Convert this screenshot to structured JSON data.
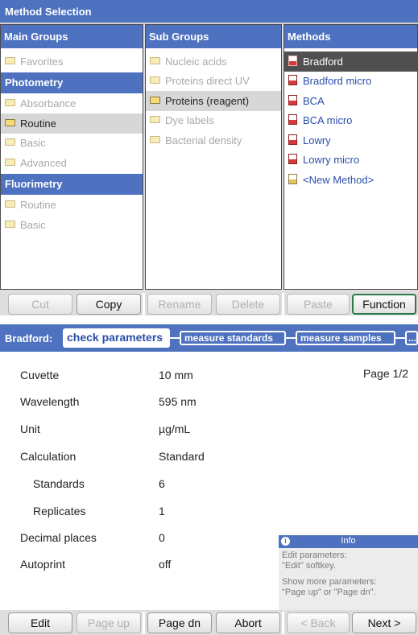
{
  "panel1": {
    "title": "Method Selection",
    "columns": {
      "main_groups": "Main Groups",
      "sub_groups": "Sub Groups",
      "methods": "Methods"
    },
    "main_groups": {
      "favorites": "Favorites",
      "photometry": "Photometry",
      "absorbance": "Absorbance",
      "routine": "Routine",
      "basic": "Basic",
      "advanced": "Advanced",
      "fluorimetry": "Fluorimetry",
      "fl_routine": "Routine",
      "fl_basic": "Basic"
    },
    "sub_groups": [
      "Nucleic acids",
      "Proteins direct UV",
      "Proteins (reagent)",
      "Dye labels",
      "Bacterial density"
    ],
    "methods": [
      "Bradford",
      "Bradford micro",
      "BCA",
      "BCA micro",
      "Lowry",
      "Lowry micro",
      "<New Method>"
    ],
    "buttons": {
      "cut": "Cut",
      "copy": "Copy",
      "rename": "Rename",
      "delete": "Delete",
      "paste": "Paste",
      "function": "Function"
    },
    "colors": {
      "accent": "#4e72c0",
      "selected_row": "#d7d7d7",
      "selected_method": "#505050",
      "function_border": "#2c7a48"
    }
  },
  "panel2": {
    "header": {
      "prefix": "Bradford:",
      "step_active": "check parameters",
      "step2": "measure standards",
      "step3": "measure samples",
      "step4": "..."
    },
    "page_indicator": "Page 1/2",
    "params": {
      "cuvette_label": "Cuvette",
      "cuvette_value": "10 mm",
      "wavelength_label": "Wavelength",
      "wavelength_value": "595 nm",
      "unit_label": "Unit",
      "unit_value": "µg/mL",
      "calc_label": "Calculation",
      "calc_value": "Standard",
      "standards_label": "Standards",
      "standards_value": "6",
      "replicates_label": "Replicates",
      "replicates_value": "1",
      "decimals_label": "Decimal places",
      "decimals_value": "0",
      "autoprint_label": "Autoprint",
      "autoprint_value": "off"
    },
    "info": {
      "title": "Info",
      "icon": "info-icon",
      "line1": "Edit parameters:",
      "line2": "\"Edit\" softkey.",
      "line3": "Show more parameters:",
      "line4": "\"Page up\" or \"Page dn\"."
    },
    "buttons": {
      "edit": "Edit",
      "page_up": "Page up",
      "page_dn": "Page dn",
      "abort": "Abort",
      "back": "< Back",
      "next": "Next >"
    }
  }
}
